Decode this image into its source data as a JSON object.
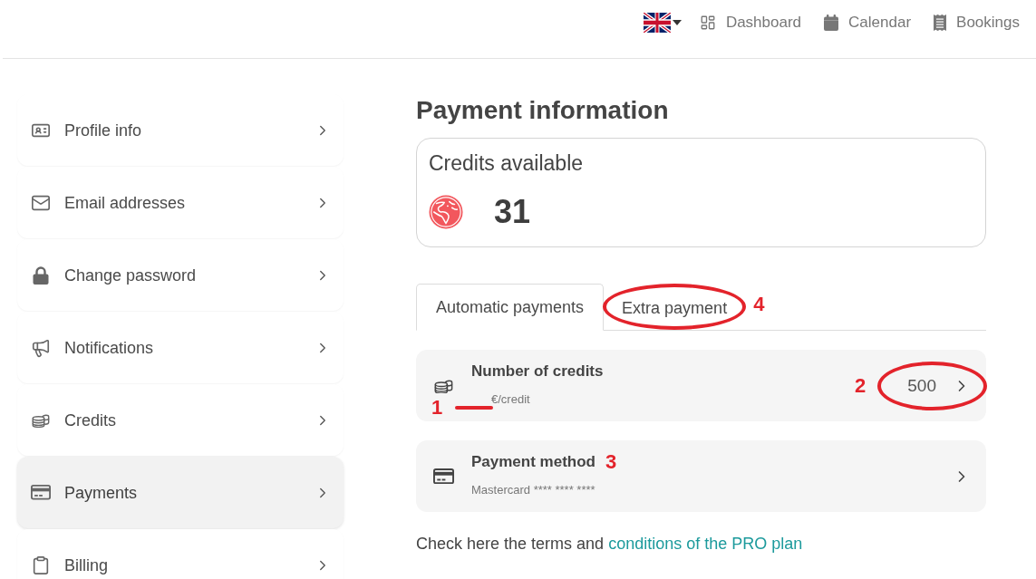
{
  "top_nav": {
    "links": [
      {
        "label": "Dashboard"
      },
      {
        "label": "Calendar"
      },
      {
        "label": "Bookings"
      }
    ]
  },
  "sidebar": {
    "items": [
      {
        "label": "Profile info",
        "selected": false
      },
      {
        "label": "Email addresses",
        "selected": false
      },
      {
        "label": "Change password",
        "selected": false
      },
      {
        "label": "Notifications",
        "selected": false
      },
      {
        "label": "Credits",
        "selected": false
      },
      {
        "label": "Payments",
        "selected": true
      },
      {
        "label": "Billing",
        "selected": false
      }
    ]
  },
  "main": {
    "title": "Payment information",
    "credits_card": {
      "label": "Credits available",
      "value": "31"
    },
    "tabs": [
      {
        "label": "Automatic payments",
        "selected": true
      },
      {
        "label": "Extra payment",
        "selected": false,
        "annotation": {
          "label": "4",
          "kind": "ellipse"
        }
      }
    ],
    "rows": [
      {
        "kind": "credits",
        "title": "Number of credits",
        "subtitle": "€/credit",
        "subtitle_annotation": {
          "label": "1",
          "kind": "underline"
        },
        "value": "500",
        "value_annotation": {
          "label": "2",
          "kind": "ellipse"
        }
      },
      {
        "kind": "card",
        "title": "Payment method",
        "title_annotation": {
          "label": "3"
        },
        "subtitle": "Mastercard **** **** ****"
      }
    ],
    "terms": {
      "text": "Check here the terms and",
      "link": "conditions of the PRO plan"
    }
  }
}
